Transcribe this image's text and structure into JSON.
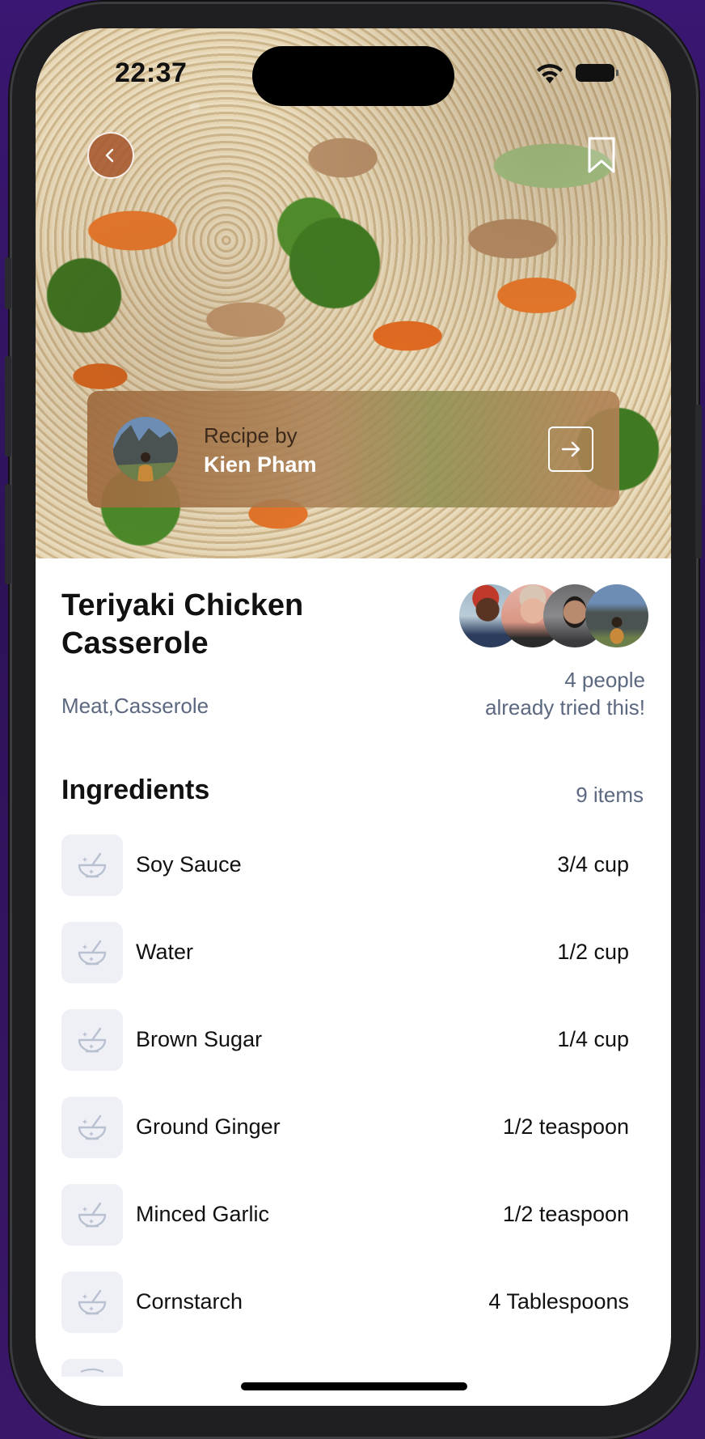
{
  "status_bar": {
    "time": "22:37"
  },
  "hero": {
    "back_icon": "chevron-left-icon",
    "bookmark_icon": "bookmark-icon"
  },
  "author": {
    "label": "Recipe by",
    "name": "Kien Pham",
    "link_icon": "arrow-right-icon"
  },
  "recipe": {
    "title": "Teriyaki Chicken Casserole",
    "category": "Meat,Casserole",
    "tried_line1": "4 people",
    "tried_line2": "already tried this!"
  },
  "ingredients": {
    "heading": "Ingredients",
    "count": "9 items",
    "items": [
      {
        "name": "Soy Sauce",
        "amount": "3/4 cup"
      },
      {
        "name": "Water",
        "amount": "1/2 cup"
      },
      {
        "name": "Brown Sugar",
        "amount": "1/4 cup"
      },
      {
        "name": "Ground Ginger",
        "amount": "1/2 teaspoon"
      },
      {
        "name": "Minced Garlic",
        "amount": "1/2 teaspoon"
      },
      {
        "name": "Cornstarch",
        "amount": "4 Tablespoons"
      }
    ]
  },
  "colors": {
    "accent_brown": "#a6582d",
    "muted_text": "#5c6880",
    "icon_bg": "#eef0f5"
  }
}
